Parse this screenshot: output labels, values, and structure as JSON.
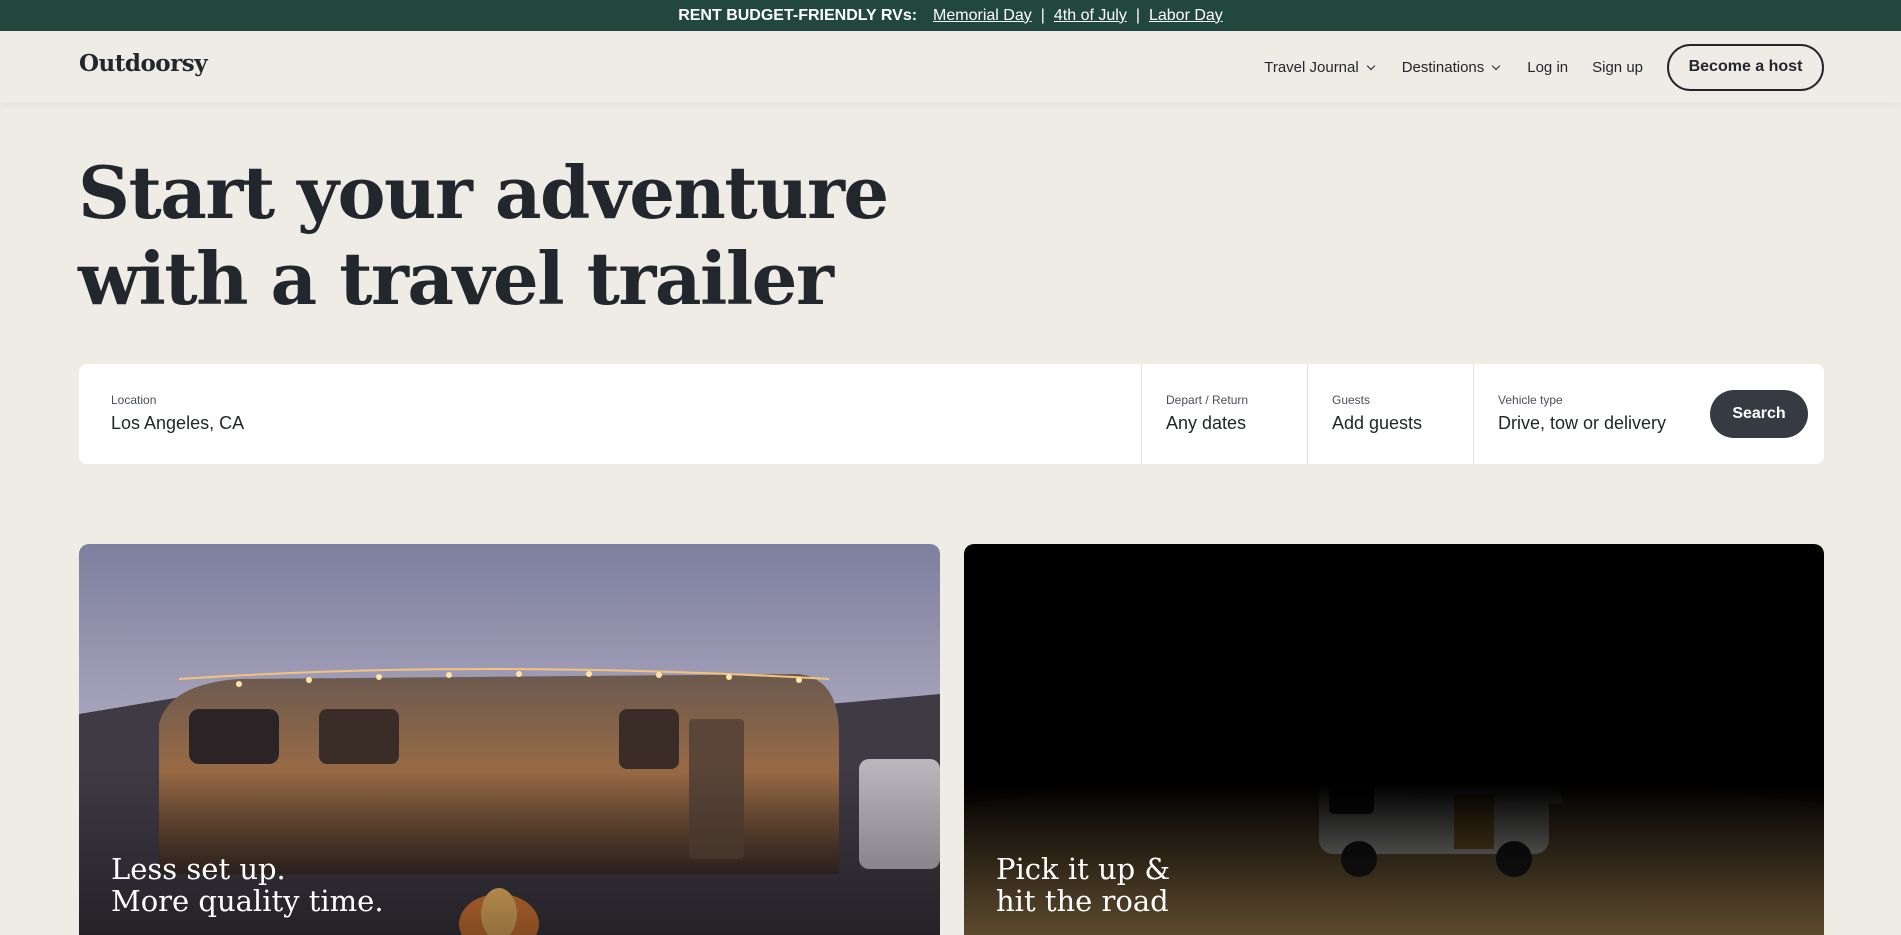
{
  "promo": {
    "lead": "RENT BUDGET-FRIENDLY RVs:",
    "links": [
      "Memorial Day",
      "4th of July",
      "Labor Day"
    ],
    "separator": "|"
  },
  "nav": {
    "logo": "Outdoorsy",
    "travel_journal": "Travel Journal",
    "destinations": "Destinations",
    "login": "Log in",
    "signup": "Sign up",
    "become_host": "Become a host"
  },
  "hero": {
    "line1": "Start your adventure",
    "line2": "with a travel trailer"
  },
  "search": {
    "location": {
      "label": "Location",
      "value": "Los Angeles, CA"
    },
    "dates": {
      "label": "Depart / Return",
      "value": "Any dates"
    },
    "guests": {
      "label": "Guests",
      "value": "Add guests"
    },
    "vehicle": {
      "label": "Vehicle type",
      "value": "Drive, tow or delivery"
    },
    "button": "Search"
  },
  "cards": [
    {
      "line1": "Less set up.",
      "line2": "More quality time."
    },
    {
      "line1": "Pick it up &",
      "line2": "hit the road"
    }
  ],
  "icons": {
    "dropdown": "chevron-down-icon"
  },
  "colors": {
    "promo_bg": "#22473c",
    "page_bg": "#efece6",
    "text": "#22272d",
    "search_btn": "#363b43"
  }
}
